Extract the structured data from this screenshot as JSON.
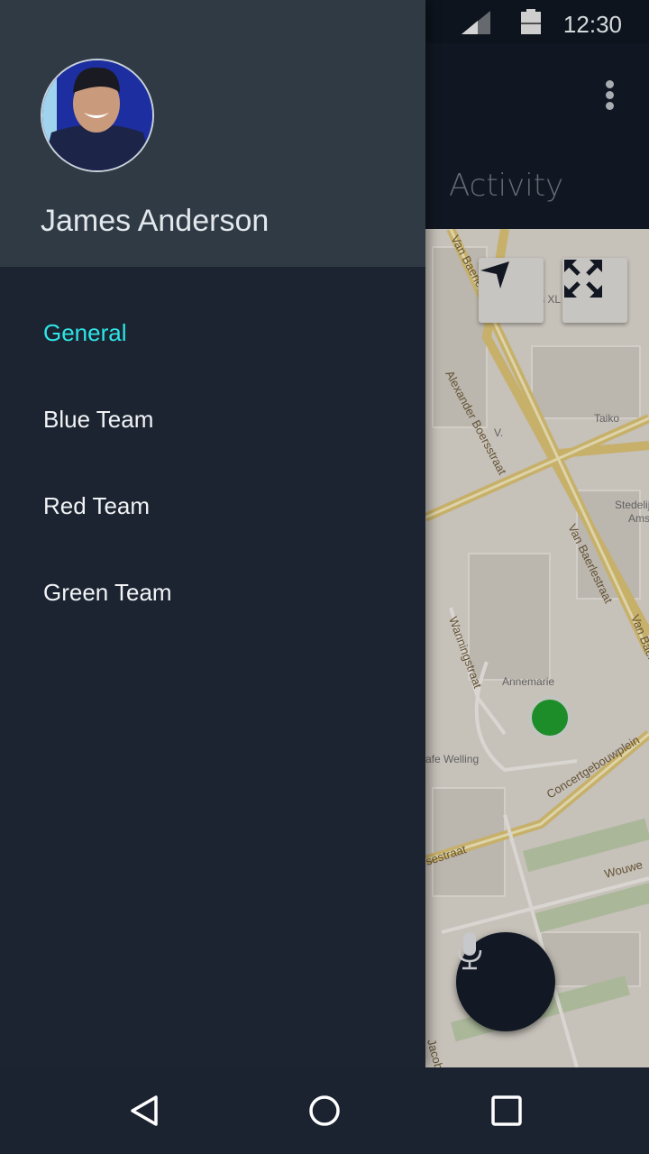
{
  "status_bar": {
    "time": "12:30",
    "icons": [
      "wifi-icon",
      "signal-icon",
      "battery-icon"
    ]
  },
  "app_bar": {
    "active_tab": "Activity",
    "overflow_icon": "more-vert-icon"
  },
  "map": {
    "labels": {
      "street1": "Van Baerlestraat",
      "street2": "Alexander Boersstraat",
      "street3": "Van Baerlestraat",
      "street4": "Wanningstraat",
      "street5": "Concertgebouwplein",
      "street6": "sestraat",
      "street7": "Wouwe",
      "street8": "Jacob",
      "street9": "Van Baerl",
      "poi1": "Taiko",
      "poi2": "Stedelijk",
      "poi2b": "Ams",
      "poi3": "Annemarie",
      "poi4": "afe Welling",
      "poi5": "s XL",
      "poi6": "V."
    },
    "marker_color": "#1f9a2c",
    "buttons": {
      "locate_icon": "navigation-arrow-icon",
      "fullscreen_icon": "expand-icon"
    }
  },
  "fab": {
    "icon": "microphone-icon"
  },
  "drawer": {
    "user_name": "James Anderson",
    "items": [
      {
        "label": "General",
        "active": true
      },
      {
        "label": "Blue Team",
        "active": false
      },
      {
        "label": "Red Team",
        "active": false
      },
      {
        "label": "Green Team",
        "active": false
      }
    ],
    "accent_color": "#2ee6e6"
  },
  "nav_bar": {
    "buttons": [
      "back",
      "home",
      "recents"
    ]
  }
}
